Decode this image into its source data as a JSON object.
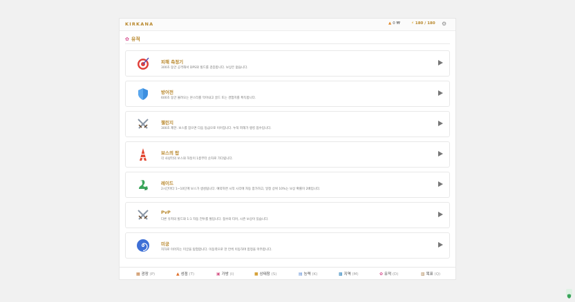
{
  "header": {
    "brand": "KIRKANA",
    "gold": "0 ₩",
    "energy": "180 / 180",
    "settings_icon": "gear-icon"
  },
  "section": {
    "title": "유적",
    "icon": "flower-icon"
  },
  "dungeons": [
    {
      "name": "피해 측정기",
      "desc": "300초 동안 공격해서 DPS와 빌드를 검증합니다. 보상은 없습니다.",
      "icon": "target-icon"
    },
    {
      "name": "방어전",
      "desc": "600초 동안 몰려오는 몬스터를 막아내고 골드 또는 경험치를 획득합니다.",
      "icon": "shield-icon"
    },
    {
      "name": "챌린지",
      "desc": "300초 제한. 보스를 잡으면 다음 등급으로 이어집니다. 누적 피해가 랭킹 점수입니다.",
      "icon": "crossed-swords-icon"
    },
    {
      "name": "보스의 탑",
      "desc": "각 사냥터의 보스와 하듯이 1층부터 순차로 가다립니다.",
      "icon": "tower-icon"
    },
    {
      "name": "레이드",
      "desc": "2시간마다 1~10단계 보스가 생성됩니다. 예약하면 시작 시각에 자동 참가하고, 일정 상위 10%는 보상 확률이 2배입니다.",
      "icon": "dragon-icon"
    },
    {
      "name": "PvP",
      "desc": "다른 유저의 빌드와 1:1 자동 전투를 벌입니다. 점수와 티어, 시즌 보상이 있습니다.",
      "icon": "crossed-swords-icon"
    },
    {
      "name": "미궁",
      "desc": "지하로 이어지는 미궁을 탐험합니다. 이동력으로 한 칸씩 이동하며 함정을 마주합니다.",
      "icon": "spiral-icon"
    }
  ],
  "nav": [
    {
      "label": "광장",
      "key": "(P)",
      "icon": "plaza-icon"
    },
    {
      "label": "성점",
      "key": "(T)",
      "icon": "fire-icon"
    },
    {
      "label": "가방",
      "key": "(I)",
      "icon": "bag-icon"
    },
    {
      "label": "상태창",
      "key": "(S)",
      "icon": "status-icon"
    },
    {
      "label": "능력",
      "key": "(K)",
      "icon": "book-icon"
    },
    {
      "label": "지역",
      "key": "(M)",
      "icon": "map-icon"
    },
    {
      "label": "유적",
      "key": "(D)",
      "icon": "flower-icon"
    },
    {
      "label": "목표",
      "key": "(Q)",
      "icon": "scroll-icon"
    }
  ],
  "colors": {
    "accent": "#b8872b",
    "background": "#f1f1f1"
  }
}
